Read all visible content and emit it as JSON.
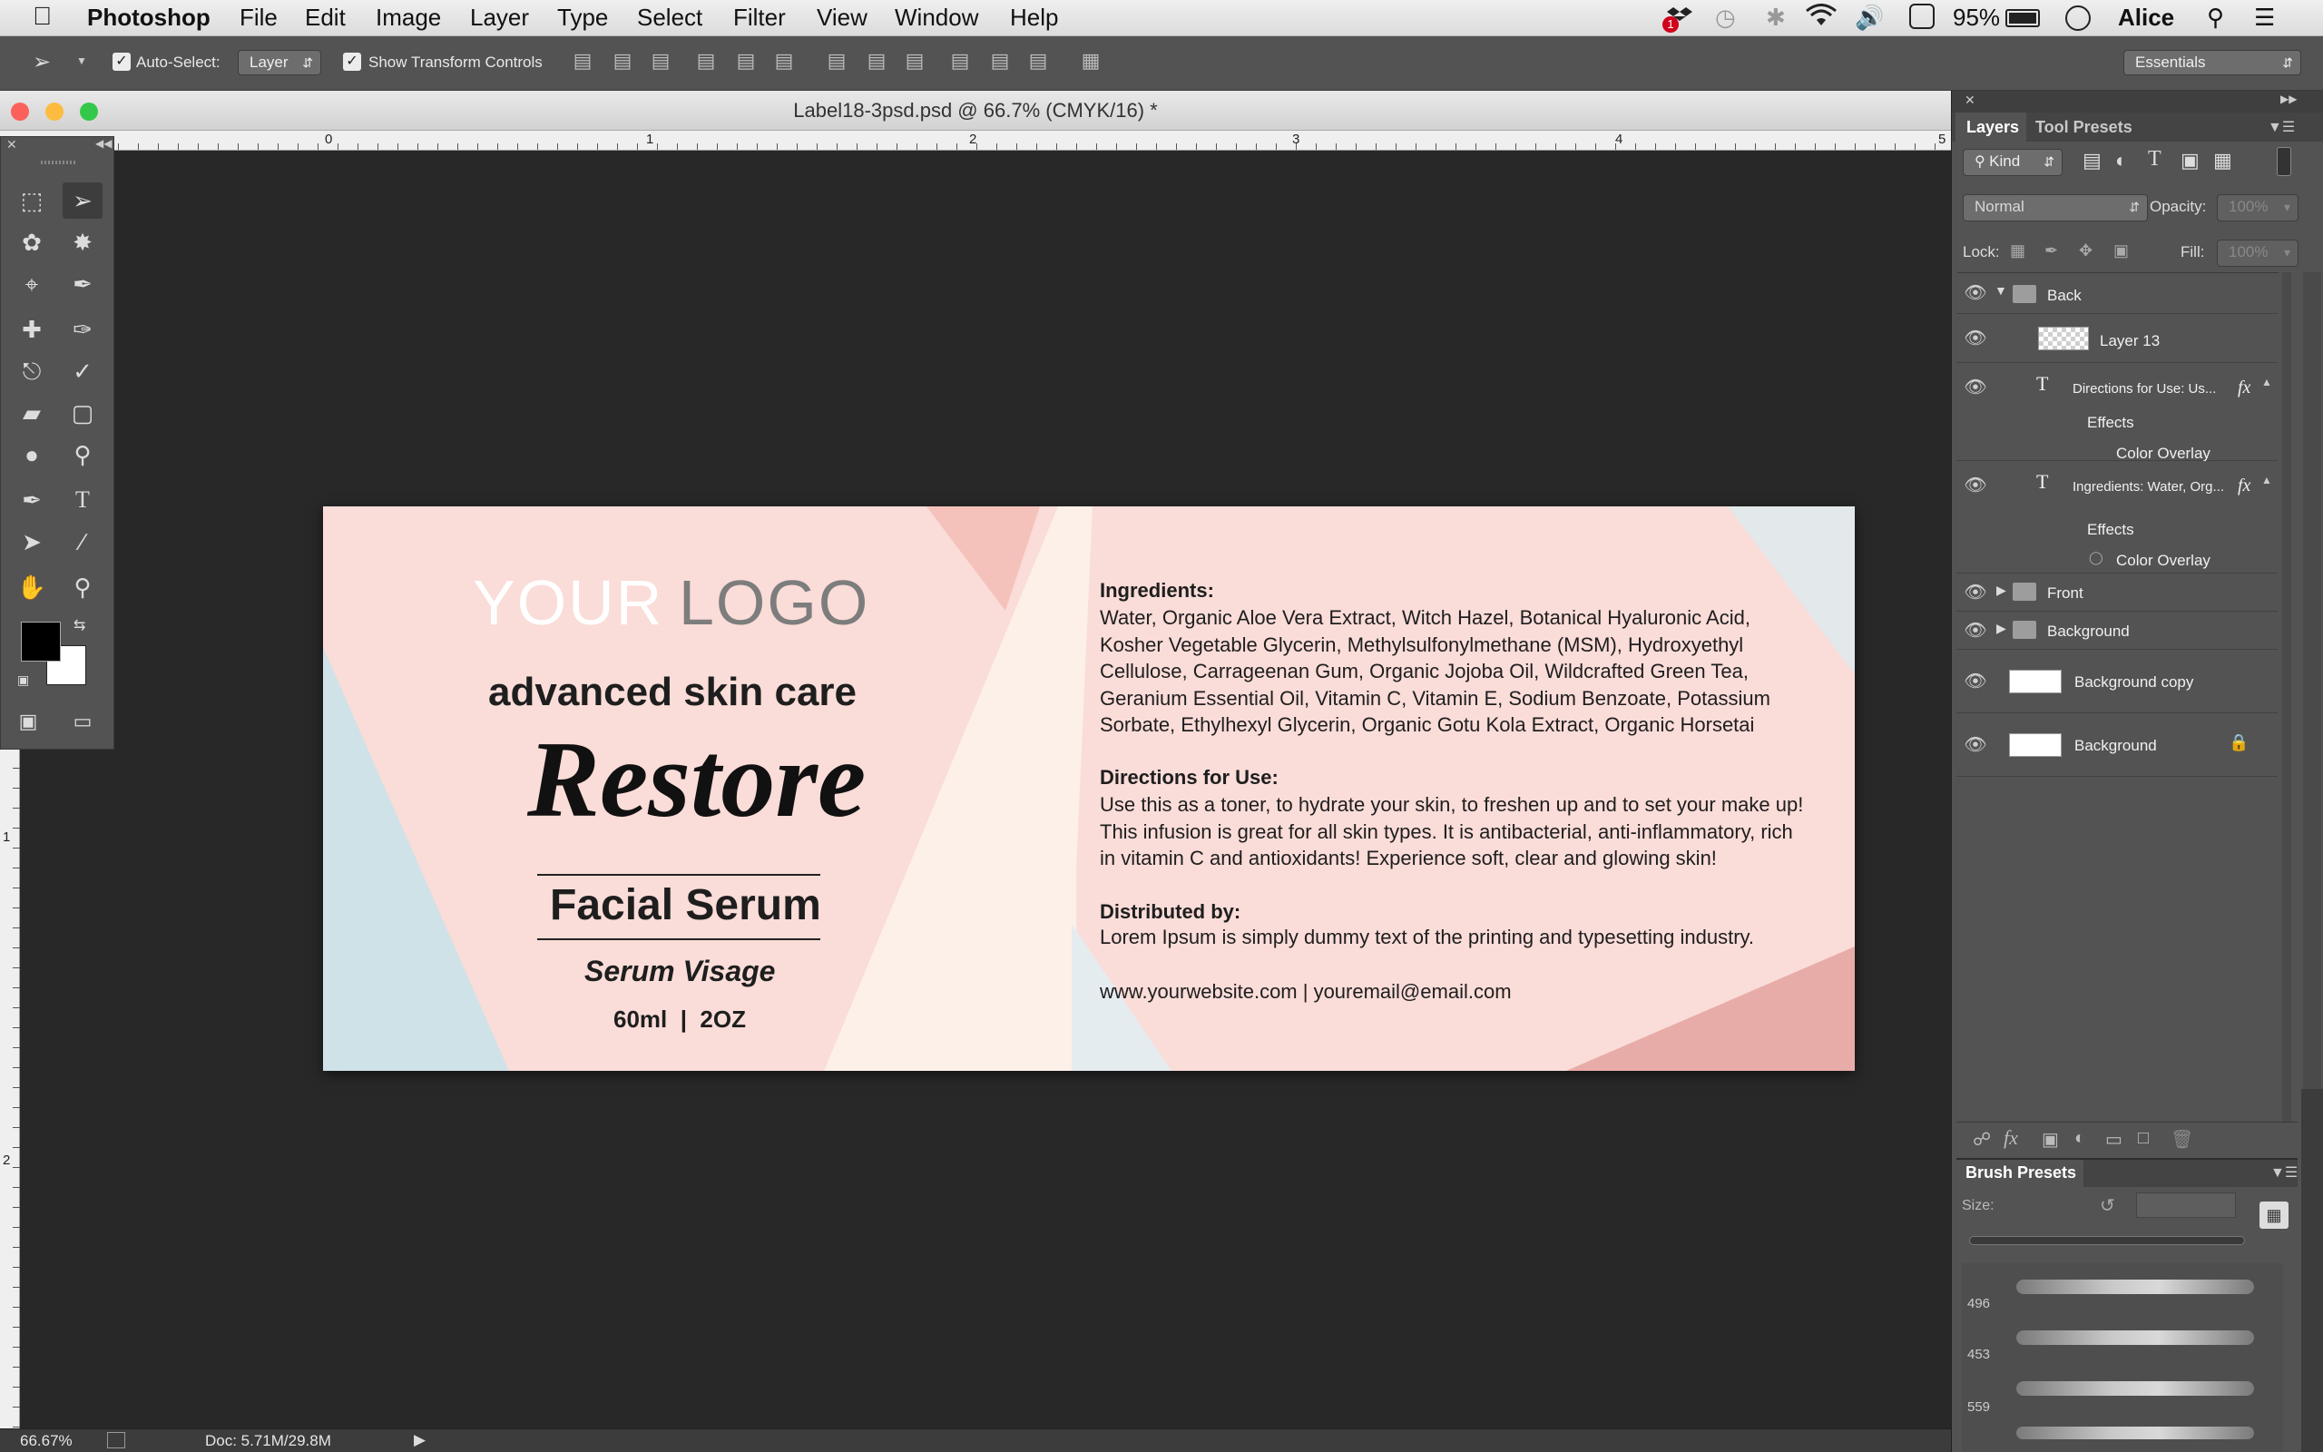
{
  "menubar": {
    "app_name": "Photoshop",
    "items": [
      "File",
      "Edit",
      "Image",
      "Layer",
      "Type",
      "Select",
      "Filter",
      "View",
      "Window",
      "Help"
    ],
    "battery": "95%",
    "user": "Alice",
    "notification_count": "1"
  },
  "options": {
    "auto_select_label": "Auto-Select:",
    "auto_select_value": "Layer",
    "show_transform_label": "Show Transform Controls",
    "workspace": "Essentials"
  },
  "document": {
    "title": "Label18-3psd.psd @ 66.7% (CMYK/16) *",
    "ruler_h": [
      "0",
      "1",
      "2",
      "3",
      "4",
      "5"
    ],
    "ruler_v": [
      "1",
      "2"
    ]
  },
  "label": {
    "logo_your": "YOUR",
    "logo_logo": "LOGO",
    "tagline": "advanced skin care",
    "product_name": "Restore",
    "product_type": "Facial Serum",
    "product_sub": "Serum Visage",
    "volume": "60ml  |  2OZ",
    "ingredients_heading": "Ingredients:",
    "ingredients_lines": [
      "Water, Organic Aloe Vera Extract, Witch Hazel, Botanical Hyaluronic Acid,",
      "Kosher Vegetable Glycerin, Methylsulfonylmethane (MSM), Hydroxyethyl",
      "Cellulose, Carrageenan Gum, Organic Jojoba Oil, Wildcrafted Green Tea,",
      "Geranium Essential Oil, Vitamin C, Vitamin E, Sodium Benzoate, Potassium",
      "Sorbate, Ethylhexyl Glycerin, Organic Gotu Kola Extract, Organic Horsetai"
    ],
    "directions_heading": "Directions for Use:",
    "directions_lines": [
      "Use this as a toner, to hydrate your skin, to freshen up and to set your make up!",
      "This infusion is great for all skin types. It is antibacterial, anti-inflammatory, rich",
      "in vitamin C and antioxidants! Experience soft, clear and glowing skin!"
    ],
    "distributed_heading": "Distributed by:",
    "distributed_text": "Lorem Ipsum is simply dummy text of the printing and typesetting industry.",
    "contact": "www.yourwebsite.com | youremail@email.com"
  },
  "status": {
    "zoom": "66.67%",
    "doc": "Doc: 5.71M/29.8M"
  },
  "layers_panel": {
    "tabs": [
      "Layers",
      "Tool Presets"
    ],
    "kind": "Kind",
    "blend_mode": "Normal",
    "opacity_label": "Opacity:",
    "opacity_value": "100%",
    "lock_label": "Lock:",
    "fill_label": "Fill:",
    "fill_value": "100%",
    "layers": [
      {
        "name": "Back"
      },
      {
        "name": "Layer 13"
      },
      {
        "name": "Directions for Use:  Us..."
      },
      {
        "name": "Effects"
      },
      {
        "name": "Color Overlay"
      },
      {
        "name": "Ingredients: Water, Org..."
      },
      {
        "name": "Effects"
      },
      {
        "name": "Color Overlay"
      },
      {
        "name": "Front"
      },
      {
        "name": "Background"
      },
      {
        "name": "Background copy"
      },
      {
        "name": "Background"
      }
    ]
  },
  "brush_panel": {
    "title": "Brush Presets",
    "size_label": "Size:",
    "sizes": [
      "496",
      "453",
      "559"
    ]
  },
  "colors": {
    "label_pink": "#fadcd8",
    "label_blue": "#cfe2e7",
    "label_cream": "#fcf0e8",
    "label_rose": "#e8aca8"
  }
}
